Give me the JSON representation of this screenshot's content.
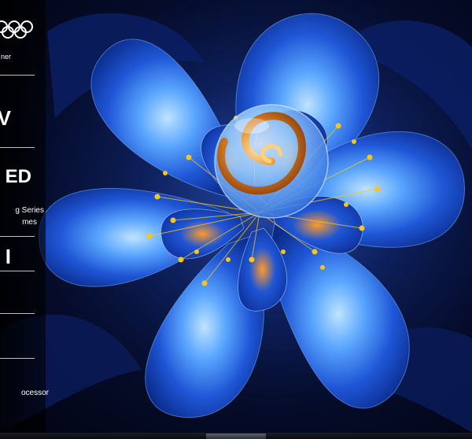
{
  "scene": {
    "subject": "blue-flower-artwork",
    "colors": {
      "petal_dark": "#0a2a8a",
      "petal_mid": "#1f56d6",
      "petal_light": "#5aa6ff",
      "highlight": "#bfe3ff",
      "gold": "#f5c518",
      "shell_orange": "#e08a28",
      "background": "#04081a"
    }
  },
  "spec_panel": {
    "partner_text": "ner",
    "heading_partial_1": "V",
    "heading_partial_2": "ED",
    "series_line_1": "g Series",
    "series_line_2": "mes",
    "heading_partial_3": "I",
    "processor_text": "ocessor"
  },
  "icons": [
    "olympic-rings-icon"
  ]
}
